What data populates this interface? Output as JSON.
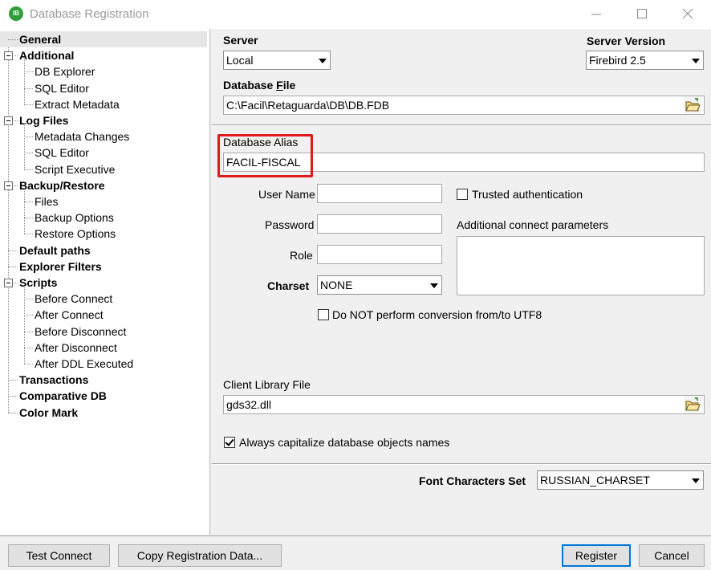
{
  "window": {
    "title": "Database Registration",
    "icon_text": "IB",
    "icon": "ibexpert-app-icon"
  },
  "tree": {
    "items": [
      {
        "label": "General",
        "level": 0,
        "selected": true,
        "expandable": false
      },
      {
        "label": "Additional",
        "level": 0,
        "expandable": true
      },
      {
        "label": "DB Explorer",
        "level": 1
      },
      {
        "label": "SQL Editor",
        "level": 1
      },
      {
        "label": "Extract Metadata",
        "level": 1
      },
      {
        "label": "Log Files",
        "level": 0,
        "expandable": true
      },
      {
        "label": "Metadata Changes",
        "level": 1
      },
      {
        "label": "SQL Editor",
        "level": 1
      },
      {
        "label": "Script Executive",
        "level": 1
      },
      {
        "label": "Backup/Restore",
        "level": 0,
        "expandable": true
      },
      {
        "label": "Files",
        "level": 1
      },
      {
        "label": "Backup Options",
        "level": 1
      },
      {
        "label": "Restore Options",
        "level": 1
      },
      {
        "label": "Default paths",
        "level": 0,
        "expandable": false
      },
      {
        "label": "Explorer Filters",
        "level": 0,
        "expandable": false
      },
      {
        "label": "Scripts",
        "level": 0,
        "expandable": true
      },
      {
        "label": "Before Connect",
        "level": 1
      },
      {
        "label": "After Connect",
        "level": 1
      },
      {
        "label": "Before Disconnect",
        "level": 1
      },
      {
        "label": "After Disconnect",
        "level": 1
      },
      {
        "label": "After DDL Executed",
        "level": 1
      },
      {
        "label": "Transactions",
        "level": 0,
        "expandable": false
      },
      {
        "label": "Comparative DB",
        "level": 0,
        "expandable": false
      },
      {
        "label": "Color Mark",
        "level": 0,
        "expandable": false
      }
    ]
  },
  "general": {
    "server_label": "Server",
    "server_value": "Local",
    "server_version_label": "Server Version",
    "server_version_value": "Firebird 2.5",
    "database_file_label_pre": "Database ",
    "database_file_label_accel": "F",
    "database_file_label_post": "ile",
    "database_file_value": "C:\\Facil\\Retaguarda\\DB\\DB.FDB",
    "database_alias_label": "Database Alias",
    "database_alias_value": "FACIL-FISCAL",
    "user_name_label": "User Name",
    "user_name_value": "",
    "password_label": "Password",
    "password_value": "",
    "role_label": "Role",
    "role_value": "",
    "charset_label": "Charset",
    "charset_value": "NONE",
    "trusted_auth_label": "Trusted authentication",
    "trusted_auth_checked": false,
    "additional_params_label": "Additional connect parameters",
    "additional_params_value": "",
    "no_utf8_conversion_label": "Do NOT perform conversion from/to UTF8",
    "no_utf8_conversion_checked": false,
    "client_library_label": "Client Library File",
    "client_library_value": "gds32.dll",
    "always_capitalize_label": "Always capitalize database objects names",
    "always_capitalize_checked": true,
    "font_charset_label": "Font Characters Set",
    "font_charset_value": "RUSSIAN_CHARSET",
    "highlight_color": "#e01a1a"
  },
  "buttons": {
    "test_connect": "Test Connect",
    "copy_registration": "Copy Registration Data...",
    "register": "Register",
    "cancel": "Cancel"
  },
  "colors": {
    "accent": "#0078d7",
    "app_icon": "#2f9e3a"
  }
}
